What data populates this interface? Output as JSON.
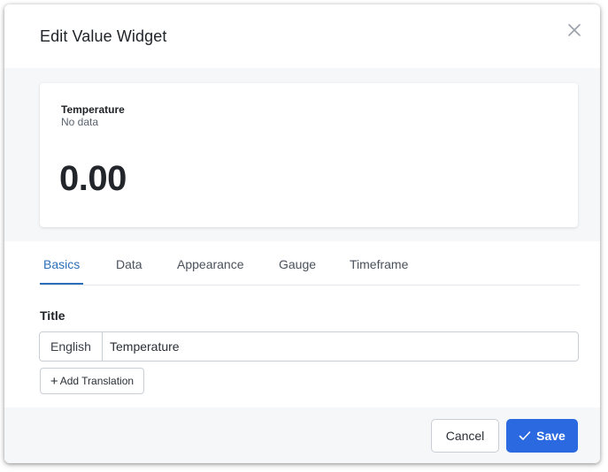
{
  "dialog": {
    "title": "Edit Value Widget",
    "close_icon": "close-icon"
  },
  "preview": {
    "widget_name": "Temperature",
    "widget_status": "No data",
    "widget_value": "0.00"
  },
  "tabs": [
    {
      "label": "Basics",
      "active": true
    },
    {
      "label": "Data",
      "active": false
    },
    {
      "label": "Appearance",
      "active": false
    },
    {
      "label": "Gauge",
      "active": false
    },
    {
      "label": "Timeframe",
      "active": false
    }
  ],
  "form": {
    "title_label": "Title",
    "language": "English",
    "title_value": "Temperature",
    "add_translation_label": "Add Translation"
  },
  "footer": {
    "cancel_label": "Cancel",
    "save_label": "Save"
  },
  "colors": {
    "accent": "#2b6fb8",
    "primary_button": "#2a69df"
  }
}
